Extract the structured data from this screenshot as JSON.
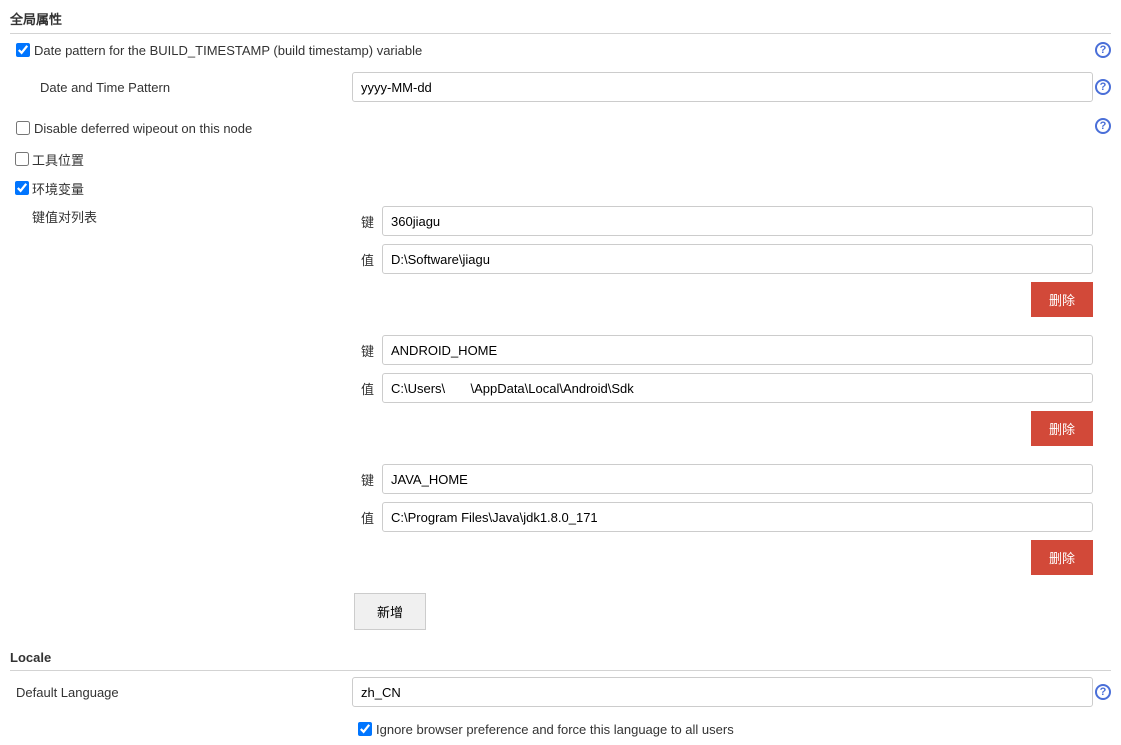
{
  "section1_title": "全局属性",
  "date_pattern_checkbox_label": "Date pattern for the BUILD_TIMESTAMP (build timestamp) variable",
  "date_time_pattern_label": "Date and Time Pattern",
  "date_time_pattern_value": "yyyy-MM-dd",
  "disable_wipeout_label": "Disable deferred wipeout on this node",
  "tool_location_label": "工具位置",
  "env_var_label": "环境变量",
  "kv_list_label": "键值对列表",
  "key_label": "键",
  "value_label": "值",
  "delete_button": "删除",
  "add_button": "新增",
  "kv_pairs": [
    {
      "key": "360jiagu",
      "value": "D:\\Software\\jiagu",
      "value_masked": false
    },
    {
      "key": "ANDROID_HOME",
      "value": "C:\\Users\\       \\AppData\\Local\\Android\\Sdk",
      "value_masked": true
    },
    {
      "key": "JAVA_HOME",
      "value": "C:\\Program Files\\Java\\jdk1.8.0_171",
      "value_masked": false
    }
  ],
  "locale_section_title": "Locale",
  "default_language_label": "Default Language",
  "default_language_value": "zh_CN",
  "ignore_browser_label": "Ignore browser preference and force this language to all users",
  "help_glyph": "?"
}
